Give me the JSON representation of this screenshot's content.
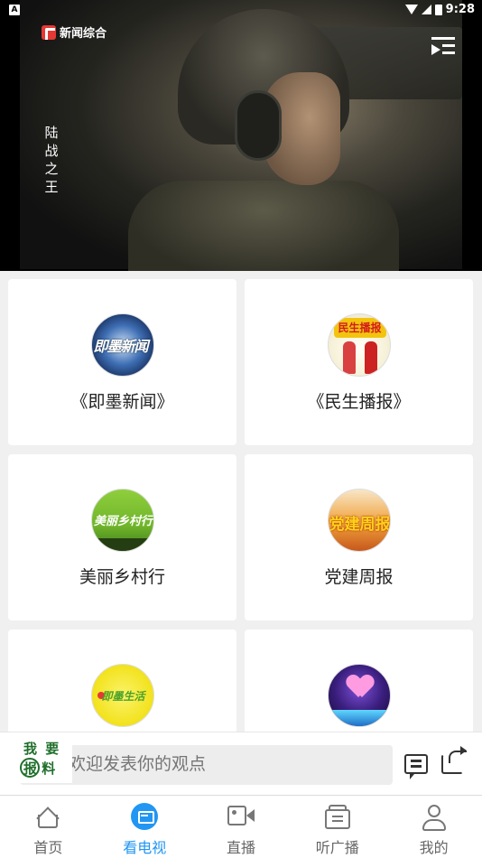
{
  "status_bar": {
    "time": "9:28",
    "notification_icon": "A"
  },
  "player": {
    "channel_name": "新闻综合",
    "program_subtitle": [
      "陆",
      "战",
      "之",
      "王"
    ]
  },
  "programs": [
    {
      "title": "《即墨新闻》",
      "thumb_text": "即墨新闻"
    },
    {
      "title": "《民生播报》",
      "thumb_text": "民生播报"
    },
    {
      "title": "美丽乡村行",
      "thumb_text": "美丽乡村行"
    },
    {
      "title": "党建周报",
      "thumb_text": "党建周报"
    },
    {
      "title": "",
      "thumb_text": "即墨生活"
    },
    {
      "title": "",
      "thumb_text": ""
    }
  ],
  "comment_bar": {
    "report_line1": "我 要",
    "report_line2": "报 料",
    "placeholder": "欢迎发表你的观点"
  },
  "bottom_nav": [
    {
      "label": "首页",
      "icon": "home-icon",
      "active": false
    },
    {
      "label": "看电视",
      "icon": "tv-icon",
      "active": true
    },
    {
      "label": "直播",
      "icon": "live-camera-icon",
      "active": false
    },
    {
      "label": "听广播",
      "icon": "radio-icon",
      "active": false
    },
    {
      "label": "我的",
      "icon": "profile-icon",
      "active": false
    }
  ],
  "colors": {
    "accent": "#2196f3",
    "report_green": "#1f6e2b"
  }
}
